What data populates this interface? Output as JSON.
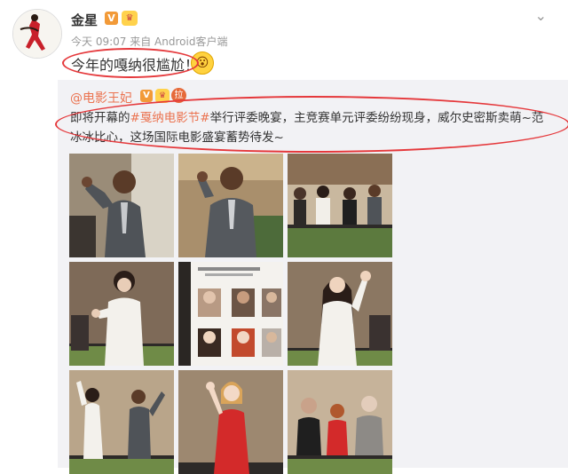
{
  "post": {
    "username": "金星",
    "verified_icon": "verified-v-icon",
    "level_icon": "vip-level-icon",
    "meta_time": "今天 09:07",
    "meta_source": "来自 Android客户端",
    "text": "今年的嘎纳很尴尬！",
    "emoji_icon": "shocked-face-icon",
    "dropdown_icon": "chevron-down-icon"
  },
  "repost": {
    "username": "@电影王妃",
    "text_before": "即将开幕的",
    "tag": "#戛纳电影节#",
    "text_after": "举行评委晚宴，主竞赛单元评委纷纷现身，威尔史密斯卖萌~范冰冰比心，这场国际电影盛宴蓄势待发~",
    "avatar_char": "拉"
  },
  "photos": [
    {
      "name": "photo-will-smith-waving-1"
    },
    {
      "name": "photo-will-smith-waving-2"
    },
    {
      "name": "photo-jury-group-balcony"
    },
    {
      "name": "photo-fan-bingbing-heart"
    },
    {
      "name": "photo-jury-member-list"
    },
    {
      "name": "photo-fan-bingbing-waving"
    },
    {
      "name": "photo-balcony-waving"
    },
    {
      "name": "photo-jessica-chastain-red-dress"
    },
    {
      "name": "photo-jury-trio-balcony"
    }
  ],
  "colors": {
    "accent": "#eb7350",
    "annotation_red": "#e5383b",
    "repost_bg": "#f2f2f5"
  }
}
